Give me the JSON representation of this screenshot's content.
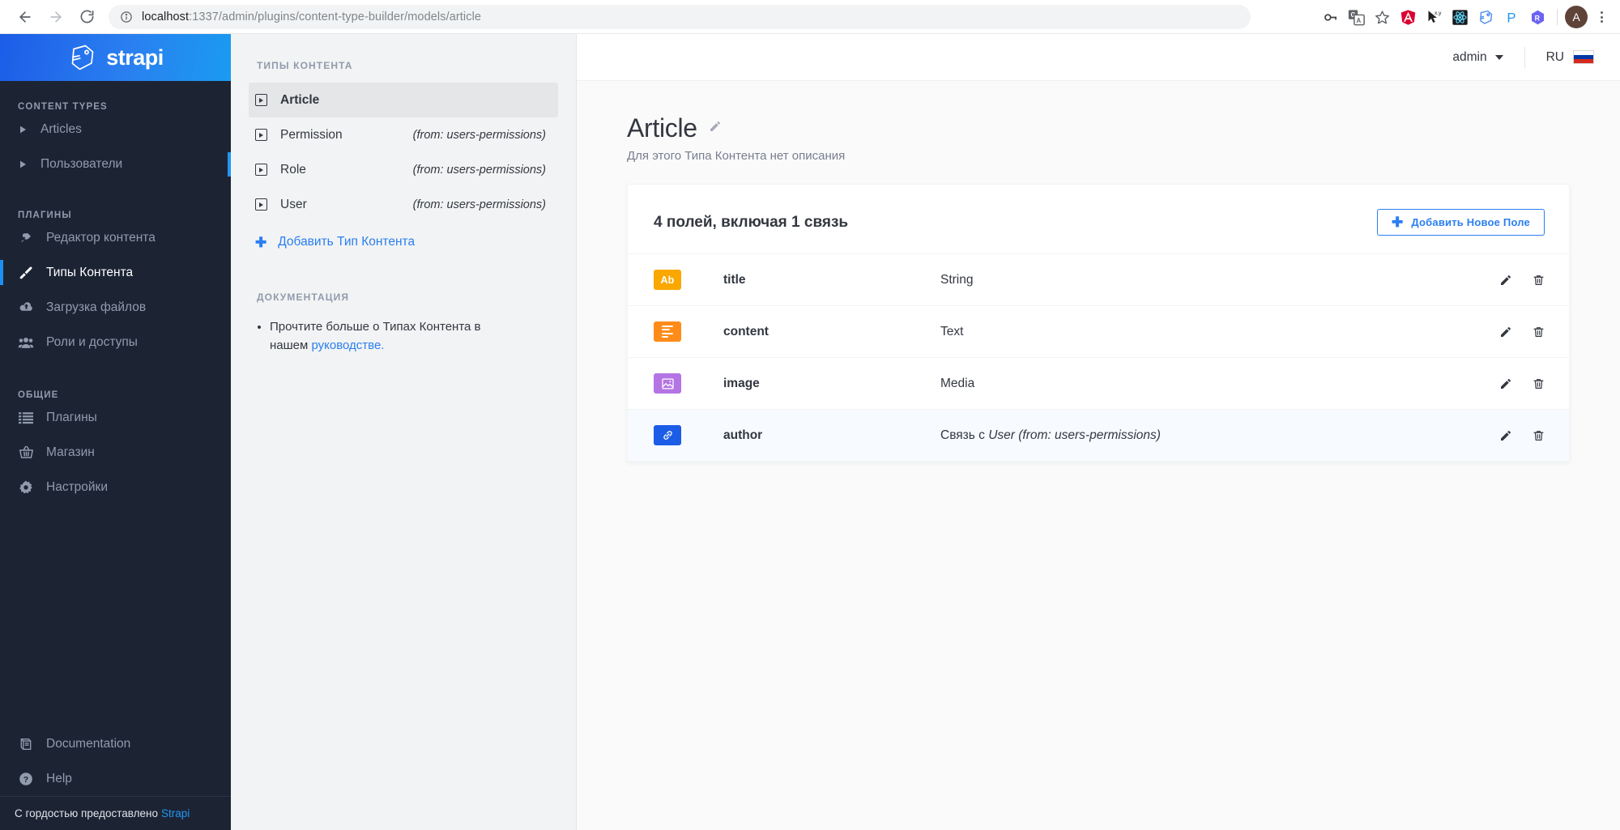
{
  "browser": {
    "back_icon": "back-arrow-icon",
    "forward_icon": "forward-arrow-icon",
    "reload_icon": "reload-icon",
    "site_info_icon": "site-info-icon",
    "url_host": "localhost",
    "url_rest": ":1337/admin/plugins/content-type-builder/models/article",
    "extensions": [
      {
        "name": "password-manager-icon",
        "glyph": "⚷",
        "color": "#3c4043"
      },
      {
        "name": "google-translate-icon",
        "glyph": "G",
        "color": "#5f6368"
      },
      {
        "name": "bookmark-star-icon",
        "glyph": "☆",
        "color": "#5f6368"
      },
      {
        "name": "angular-devtools-icon",
        "glyph": "A",
        "color": "#dd0031"
      },
      {
        "name": "cursor-coordinates-icon",
        "glyph": "x,y",
        "color": "#202124"
      },
      {
        "name": "react-devtools-icon",
        "glyph": "⚛",
        "color": "#61dafb"
      },
      {
        "name": "strapi-extension-icon",
        "glyph": "S",
        "color": "#4b8bf5"
      },
      {
        "name": "p-extension-icon",
        "glyph": "P",
        "color": "#2196f3"
      },
      {
        "name": "r-extension-icon",
        "glyph": "R",
        "color": "#6c63f5"
      }
    ],
    "profile_initial": "A",
    "menu_icon": "kebab-menu-icon"
  },
  "sidebar": {
    "brand": "strapi",
    "brand_logo_icon": "strapi-logo-icon",
    "sections": [
      {
        "title": "CONTENT TYPES",
        "items": [
          {
            "label": "Articles",
            "icon": "chevron-right-icon",
            "active": false
          },
          {
            "label": "Пользователи",
            "icon": "chevron-right-icon",
            "active": false
          }
        ]
      },
      {
        "title": "ПЛАГИНЫ",
        "items": [
          {
            "label": "Редактор контента",
            "icon": "plug-icon",
            "active": false
          },
          {
            "label": "Типы Контента",
            "icon": "paintbrush-icon",
            "active": true
          },
          {
            "label": "Загрузка файлов",
            "icon": "cloud-upload-icon",
            "active": false
          },
          {
            "label": "Роли и доступы",
            "icon": "users-icon",
            "active": false
          }
        ]
      },
      {
        "title": "ОБЩИЕ",
        "items": [
          {
            "label": "Плагины",
            "icon": "list-icon",
            "active": false
          },
          {
            "label": "Магазин",
            "icon": "shopping-basket-icon",
            "active": false
          },
          {
            "label": "Настройки",
            "icon": "gear-icon",
            "active": false
          }
        ]
      }
    ],
    "bottom_items": [
      {
        "label": "Documentation",
        "icon": "book-icon"
      },
      {
        "label": "Help",
        "icon": "question-circle-icon"
      }
    ],
    "footer_text": "С гордостью предоставлено",
    "footer_link": "Strapi"
  },
  "panel": {
    "title": "ТИПЫ КОНТЕНТА",
    "content_types": [
      {
        "name": "Article",
        "from": "",
        "selected": true
      },
      {
        "name": "Permission",
        "from": "(from: users-permissions)",
        "selected": false
      },
      {
        "name": "Role",
        "from": "(from: users-permissions)",
        "selected": false
      },
      {
        "name": "User",
        "from": "(from: users-permissions)",
        "selected": false
      }
    ],
    "add_label": "Добавить Тип Контента",
    "add_icon": "plus-icon",
    "doc_title": "ДОКУМЕНТАЦИЯ",
    "doc_text_before": "Прочтите больше о Типах Контента в нашем ",
    "doc_link": "руководстве."
  },
  "topbar": {
    "user": "admin",
    "user_caret_icon": "chevron-down-icon",
    "language": "RU",
    "flag_icon": "russia-flag-icon"
  },
  "main": {
    "title": "Article",
    "title_edit_icon": "pencil-icon",
    "subtitle": "Для этого Типа Контента нет описания",
    "card_title": "4 полей, включая 1 связь",
    "add_field_label": "Добавить Новое Поле",
    "add_field_icon": "plus-icon",
    "fields": [
      {
        "name": "title",
        "type": "String",
        "type_prefix": "",
        "type_italic": "",
        "badge": "Ab",
        "badge_kind": "text-ab",
        "badge_color": "#faa700",
        "highlight": false
      },
      {
        "name": "content",
        "type": "Text",
        "type_prefix": "",
        "type_italic": "",
        "badge": "",
        "badge_kind": "text-lines",
        "badge_color": "#ff8c19",
        "highlight": false
      },
      {
        "name": "image",
        "type": "Media",
        "type_prefix": "",
        "type_italic": "",
        "badge": "",
        "badge_kind": "image",
        "badge_color": "#b474e4",
        "highlight": false
      },
      {
        "name": "author",
        "type": "",
        "type_prefix": "Связь с ",
        "type_italic": "User (from: users-permissions)",
        "badge": "",
        "badge_kind": "relation",
        "badge_color": "#1c5de7",
        "highlight": true
      }
    ],
    "row_edit_icon": "pencil-icon",
    "row_delete_icon": "trash-icon"
  },
  "colors": {
    "brand_blue": "#2a7ff0",
    "sidebar_bg": "#1c2434",
    "panel_bg": "#f2f3f4",
    "main_bg": "#fafafb",
    "accent_active": "#1c8ff0"
  }
}
